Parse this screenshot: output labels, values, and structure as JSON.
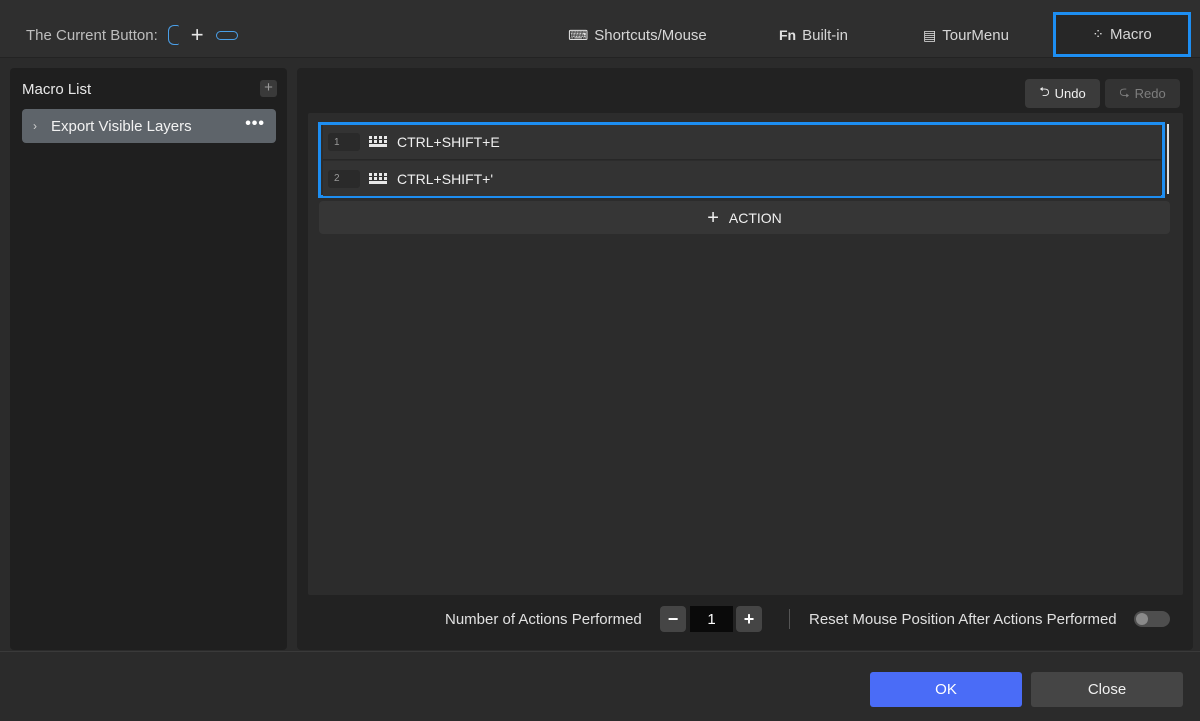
{
  "header": {
    "current_button_label": "The Current Button:",
    "current_button_plus": "+",
    "tabs": [
      {
        "label": "Shortcuts/Mouse",
        "icon": "keyboard-mouse-icon",
        "active": false
      },
      {
        "label": "Built-in",
        "icon": "fn-icon",
        "active": false
      },
      {
        "label": "TourMenu",
        "icon": "tourmenu-icon",
        "active": false
      },
      {
        "label": "Macro",
        "icon": "macro-icon",
        "active": true
      }
    ]
  },
  "macro_list": {
    "title": "Macro List",
    "add_icon": "+",
    "items": [
      {
        "label": "Export Visible Layers",
        "selected": true
      }
    ],
    "more_icon": "•••"
  },
  "editor": {
    "undo_label": "Undo",
    "redo_label": "Redo",
    "actions": [
      {
        "index": "1",
        "icon": "keyboard-icon",
        "text": "CTRL+SHIFT+E"
      },
      {
        "index": "2",
        "icon": "keyboard-icon",
        "text": "CTRL+SHIFT+'"
      }
    ],
    "add_action_label": "ACTION",
    "add_action_plus": "+"
  },
  "settings": {
    "actions_performed_label": "Number of Actions Performed",
    "actions_performed_value": "1",
    "minus_label": "−",
    "plus_label": "+",
    "reset_mouse_label": "Reset Mouse Position After Actions Performed",
    "reset_mouse_enabled": false
  },
  "footer": {
    "ok_label": "OK",
    "close_label": "Close"
  },
  "colors": {
    "accent": "#1d8ef2",
    "primary_button": "#4a6cf7",
    "background": "#2b2b2b"
  }
}
